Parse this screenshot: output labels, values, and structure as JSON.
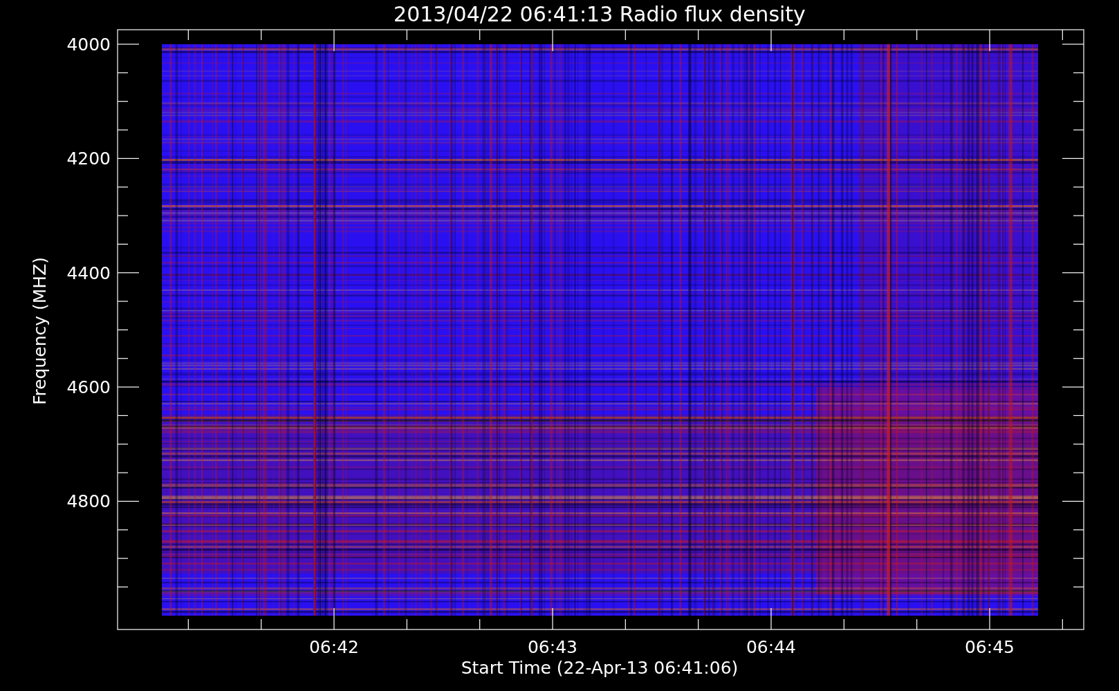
{
  "title": "2013/04/22 06:41:13 Radio flux density",
  "y_axis": {
    "label": "Frequency (MHZ)",
    "ticks": [
      "4000",
      "4200",
      "4400",
      "4600",
      "4800"
    ]
  },
  "x_axis": {
    "label": "Start Time (22-Apr-13 06:41:06)",
    "ticks": [
      "06:42",
      "06:43",
      "06:44",
      "06:45"
    ]
  }
}
